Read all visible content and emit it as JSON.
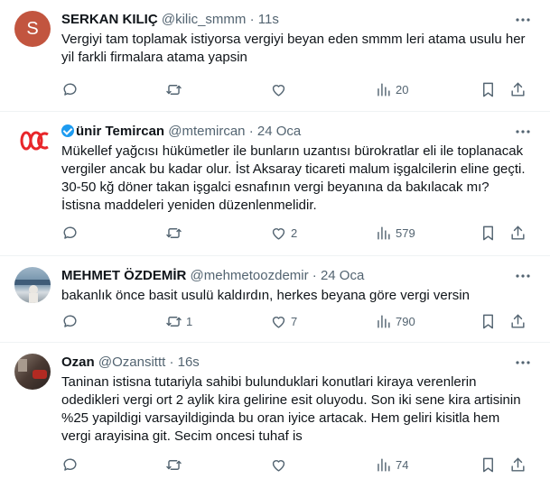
{
  "tweets": [
    {
      "name": "SERKAN KILIÇ",
      "handle": "@kilic_smmm",
      "dot": "·",
      "time": "11s",
      "avatar_letter": "S",
      "avatar_color": "#c2553f",
      "text": "Vergiyi tam toplamak istiyorsa vergiyi beyan eden smmm leri atama usulu her yil farkli firmalara atama yapsin",
      "replies": "",
      "retweets": "",
      "likes": "",
      "views": "20"
    },
    {
      "name": "ünir Temircan",
      "name_prefix_icon": "verified-m-badge",
      "handle": "@mtemircan",
      "dot": "·",
      "time": "24 Oca",
      "avatar_color": "#e8262a",
      "text": "Mükellef yağcısı hükümetler  ile bunların uzantısı bürokratlar eli ile toplanacak vergiler ancak bu kadar olur. İst Aksaray ticareti malum işgalcilerin eline geçti. 30-50 kğ döner takan işgalci esnafının vergi beyanına da bakılacak mı? İstisna maddeleri yeniden düzenlenmelidir.",
      "replies": "",
      "retweets": "",
      "likes": "2",
      "views": "579"
    },
    {
      "name": "MEHMET ÖZDEMİR",
      "handle": "@mehmetoozdemir",
      "dot": "·",
      "time": "24 Oca",
      "avatar_color": "#6f8fa8",
      "text": "bakanlık önce basit usulü kaldırdın, herkes beyana göre vergi versin",
      "replies": "",
      "retweets": "1",
      "likes": "7",
      "views": "790"
    },
    {
      "name": "Ozan",
      "handle": "@Ozansittt",
      "dot": "·",
      "time": "16s",
      "avatar_color": "#5a4a44",
      "text": "Taninan istisna tutariyla sahibi bulunduklari konutlari kiraya verenlerin odedikleri vergi ort 2 aylik kira gelirine esit oluyodu. Son iki sene kira artisinin %25 yapildigi varsayildiginda bu oran iyice artacak. Hem geliri kisitla hem vergi arayisina git. Secim oncesi tuhaf is",
      "replies": "",
      "retweets": "",
      "likes": "",
      "views": "74"
    }
  ]
}
